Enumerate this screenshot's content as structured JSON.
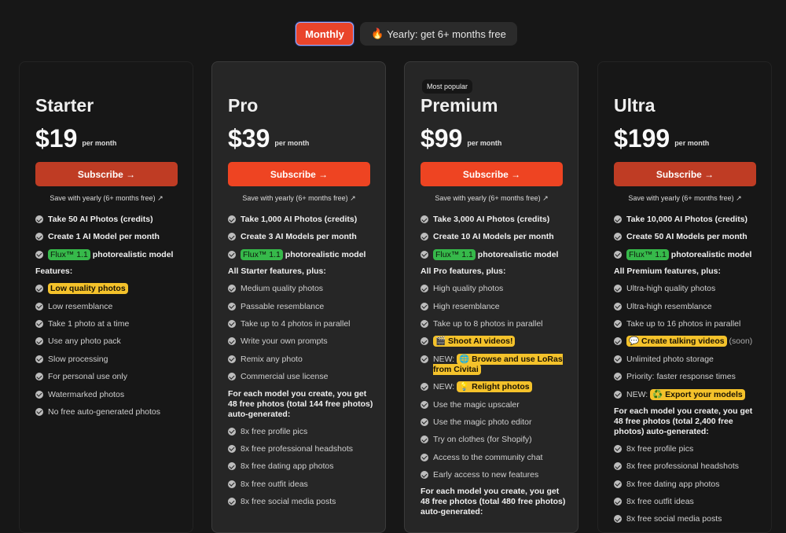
{
  "toggle": {
    "monthly": "Monthly",
    "yearly_icon": "🔥",
    "yearly": "Yearly: get 6+ months free"
  },
  "plans": [
    {
      "name": "Starter",
      "price": "$19",
      "per": "per month",
      "cta": "Subscribe →",
      "save": "Save with yearly (6+ months free) ↗",
      "items": [
        {
          "t": "Take 50 AI Photos (credits)",
          "b": true
        },
        {
          "t": "Create 1 AI Model per month",
          "b": true
        },
        {
          "h": "Flux™ 1.1",
          "t": " photorealistic model",
          "b": true
        },
        {
          "head": "Features:"
        },
        {
          "y": "Low quality photos"
        },
        {
          "t": "Low resemblance"
        },
        {
          "t": "Take 1 photo at a time"
        },
        {
          "t": "Use any photo pack"
        },
        {
          "t": "Slow processing"
        },
        {
          "t": "For personal use only"
        },
        {
          "t": "Watermarked photos"
        },
        {
          "t": "No free auto-generated photos"
        }
      ]
    },
    {
      "name": "Pro",
      "price": "$39",
      "per": "per month",
      "cta": "Subscribe →",
      "save": "Save with yearly (6+ months free) ↗",
      "items": [
        {
          "t": "Take 1,000 AI Photos (credits)",
          "b": true
        },
        {
          "t": "Create 3 AI Models per month",
          "b": true
        },
        {
          "h": "Flux™ 1.1",
          "t": " photorealistic model",
          "b": true
        },
        {
          "head": "All Starter features, plus:"
        },
        {
          "t": "Medium quality photos"
        },
        {
          "t": "Passable resemblance"
        },
        {
          "t": "Take up to 4 photos in parallel"
        },
        {
          "t": "Write your own prompts"
        },
        {
          "t": "Remix any photo"
        },
        {
          "t": "Commercial use license"
        },
        {
          "head": "For each model you create, you get 48 free photos (total 144 free photos) auto-generated:"
        },
        {
          "t": "8x free profile pics"
        },
        {
          "t": "8x free professional headshots"
        },
        {
          "t": "8x free dating app photos"
        },
        {
          "t": "8x free outfit ideas"
        },
        {
          "t": "8x free social media posts"
        }
      ]
    },
    {
      "name": "Premium",
      "price": "$99",
      "per": "per month",
      "badge": "Most popular",
      "cta": "Subscribe →",
      "save": "Save with yearly (6+ months free) ↗",
      "items": [
        {
          "t": "Take 3,000 AI Photos (credits)",
          "b": true
        },
        {
          "t": "Create 10 AI Models per month",
          "b": true
        },
        {
          "h": "Flux™ 1.1",
          "t": " photorealistic model",
          "b": true
        },
        {
          "head": "All Pro features, plus:"
        },
        {
          "t": "High quality photos"
        },
        {
          "t": "High resemblance"
        },
        {
          "t": "Take up to 8 photos in parallel"
        },
        {
          "y": "🎬 Shoot AI videos!"
        },
        {
          "pre": "NEW: ",
          "y": "🌐 Browse and use LoRas from Civitai"
        },
        {
          "pre": "NEW: ",
          "y": "💡 Relight photos"
        },
        {
          "t": "Use the magic upscaler"
        },
        {
          "t": "Use the magic photo editor"
        },
        {
          "t": "Try on clothes (for Shopify)"
        },
        {
          "t": "Access to the community chat"
        },
        {
          "t": "Early access to new features"
        },
        {
          "head": "For each model you create, you get 48 free photos (total 480 free photos) auto-generated:"
        }
      ]
    },
    {
      "name": "Ultra",
      "price": "$199",
      "per": "per month",
      "cta": "Subscribe →",
      "save": "Save with yearly (6+ months free) ↗",
      "items": [
        {
          "t": "Take 10,000 AI Photos (credits)",
          "b": true
        },
        {
          "t": "Create 50 AI Models per month",
          "b": true
        },
        {
          "h": "Flux™ 1.1",
          "t": " photorealistic model",
          "b": true
        },
        {
          "head": "All Premium features, plus:"
        },
        {
          "t": "Ultra-high quality photos"
        },
        {
          "t": "Ultra-high resemblance"
        },
        {
          "t": "Take up to 16 photos in parallel"
        },
        {
          "y": "💬 Create talking videos",
          "post": " (soon)"
        },
        {
          "t": "Unlimited photo storage"
        },
        {
          "t": "Priority: faster response times"
        },
        {
          "pre": "NEW: ",
          "y": "♻️ Export your models"
        },
        {
          "head": "For each model you create, you get 48 free photos (total 2,400 free photos) auto-generated:"
        },
        {
          "t": "8x free profile pics"
        },
        {
          "t": "8x free professional headshots"
        },
        {
          "t": "8x free dating app photos"
        },
        {
          "t": "8x free outfit ideas"
        },
        {
          "t": "8x free social media posts"
        }
      ]
    }
  ]
}
